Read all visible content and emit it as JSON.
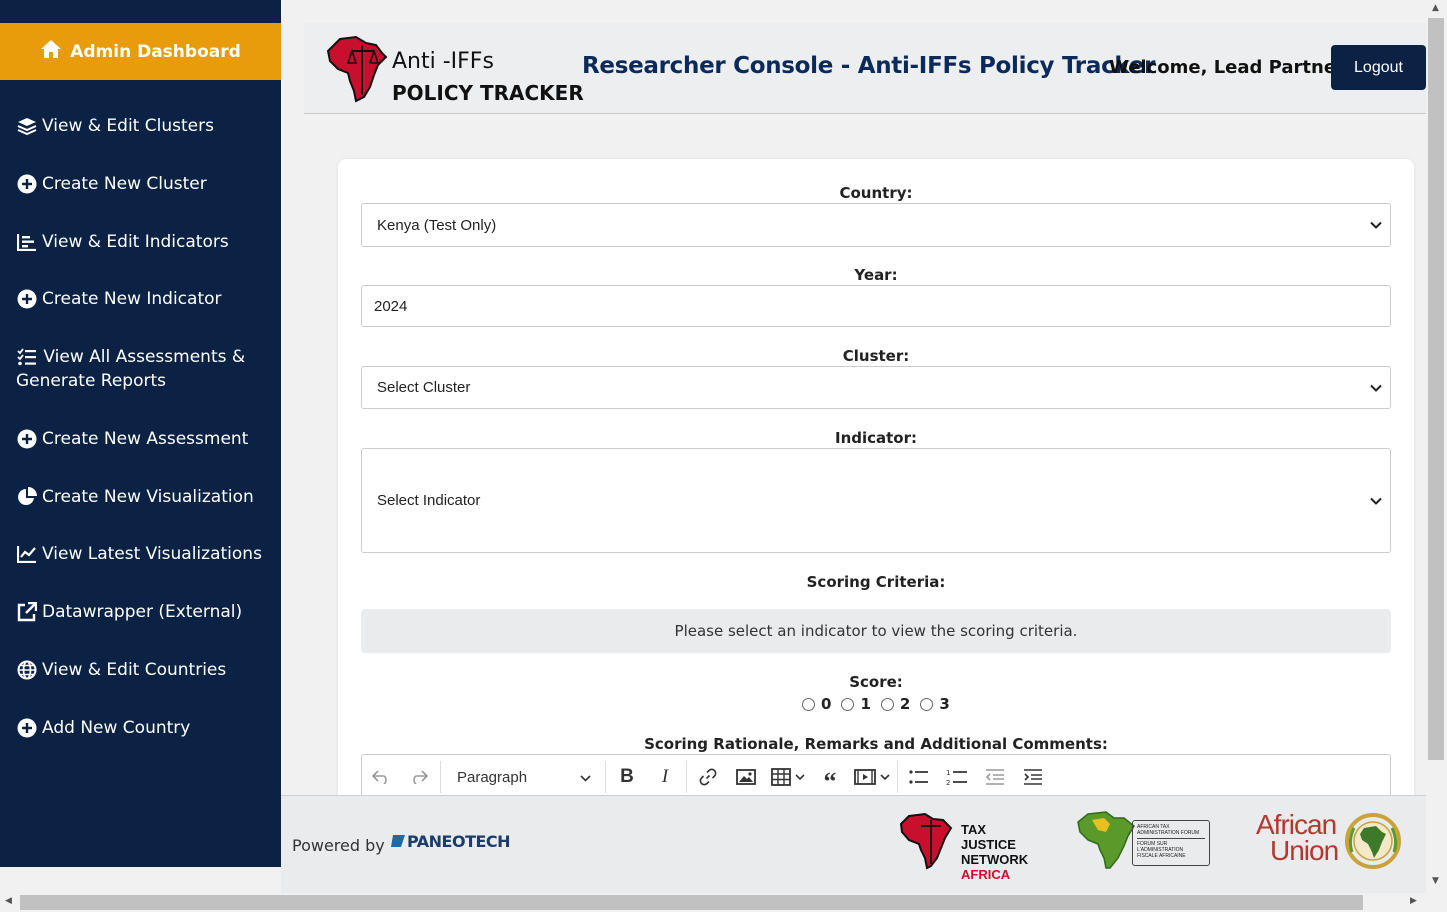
{
  "sidebar": {
    "home_label": "Admin Dashboard",
    "items": [
      {
        "label": "View & Edit Clusters",
        "icon": "layers-icon"
      },
      {
        "label": "Create New Cluster",
        "icon": "plus-circle-icon"
      },
      {
        "label": "View & Edit Indicators",
        "icon": "bar-chart-icon"
      },
      {
        "label": "Create New Indicator",
        "icon": "plus-circle-icon"
      },
      {
        "label_line1": "View All Assessments &",
        "label_line2": "Generate Reports",
        "icon": "list-check-icon"
      },
      {
        "label": "Create New Assessment",
        "icon": "plus-circle-icon"
      },
      {
        "label": "Create New Visualization",
        "icon": "pie-chart-icon"
      },
      {
        "label": "View Latest Visualizations",
        "icon": "line-chart-icon"
      },
      {
        "label": "Datawrapper (External)",
        "icon": "external-link-icon"
      },
      {
        "label": "View & Edit Countries",
        "icon": "globe-icon"
      },
      {
        "label": "Add New Country",
        "icon": "plus-circle-icon"
      }
    ]
  },
  "header": {
    "logo_line1": "Anti -IFFs",
    "logo_line2": "POLICY TRACKER",
    "title": "Researcher Console - Anti-IFFs Policy Tracker",
    "welcome": "Welcome, Lead Partner!",
    "logout_label": "Logout"
  },
  "form": {
    "country_label": "Country:",
    "country_value": "Kenya (Test Only)",
    "year_label": "Year:",
    "year_value": "2024",
    "cluster_label": "Cluster:",
    "cluster_value": "Select Cluster",
    "indicator_label": "Indicator:",
    "indicator_value": "Select Indicator",
    "criteria_label": "Scoring Criteria:",
    "criteria_message": "Please select an indicator to view the scoring criteria.",
    "score_label": "Score:",
    "score_options": [
      "0",
      "1",
      "2",
      "3"
    ],
    "rationale_label": "Scoring Rationale, Remarks and Additional Comments:",
    "editor_format": "Paragraph"
  },
  "footer": {
    "powered_by": "Powered by",
    "paneo_brand": "PANEOTECH",
    "tjn_line1": "TAX JUSTICE",
    "tjn_line2": "NETWORK",
    "tjn_line3": "AFRICA",
    "atf_line1": "AFRICAN TAX",
    "atf_line2": "ADMINISTRATION FORUM",
    "atf_line3": "FORUM SUR",
    "atf_line4": "L'ADMINISTRATION",
    "atf_line5": "FISCALE AFRICAINE",
    "au_line1": "African",
    "au_line2": "Union"
  },
  "colors": {
    "sidebar_bg": "#0b2244",
    "accent": "#e89c0c",
    "title": "#0b2a5a"
  }
}
